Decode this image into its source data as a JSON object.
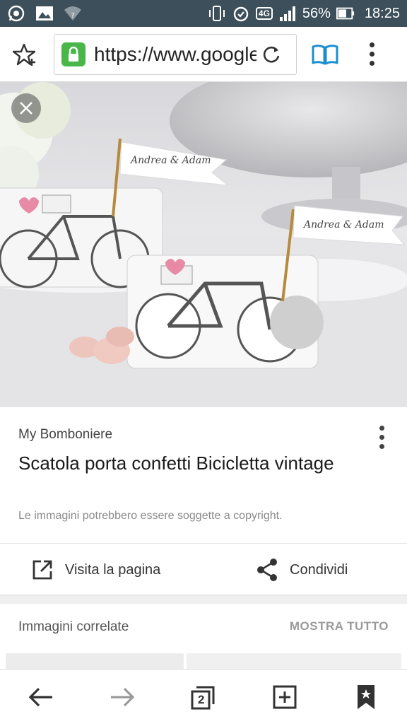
{
  "status_bar": {
    "battery_percent": "56%",
    "time": "18:25",
    "network": "4G",
    "icons": [
      "whatsapp-icon",
      "gallery-icon",
      "wifi-icon",
      "vibrate-icon",
      "alarm-icon",
      "signal-icon",
      "battery-icon"
    ]
  },
  "toolbar": {
    "url": "https://www.google.it/imgres",
    "icons": [
      "star-add-icon",
      "lock-icon",
      "reload-icon",
      "reader-mode-icon",
      "more-vert-icon"
    ]
  },
  "hero": {
    "close_icon": "close-icon"
  },
  "card": {
    "source": "My Bomboniere",
    "title": "Scatola porta confetti Bicicletta vintage",
    "copyright_note": "Le immagini potrebbero essere soggette a copyright.",
    "visit_label": "Visita la pagina",
    "share_label": "Condividi"
  },
  "related": {
    "title": "Immagini correlate",
    "show_all": "MOSTRA TUTTO"
  },
  "bottom_nav": {
    "tab_count": "2",
    "icons": [
      "back-arrow-icon",
      "forward-arrow-icon",
      "tabs-icon",
      "new-tab-icon",
      "bookmark-icon"
    ]
  },
  "colors": {
    "status_bar": "#3c4f5a",
    "lock_green": "#49b649",
    "reader_blue": "#1a8fd0"
  }
}
